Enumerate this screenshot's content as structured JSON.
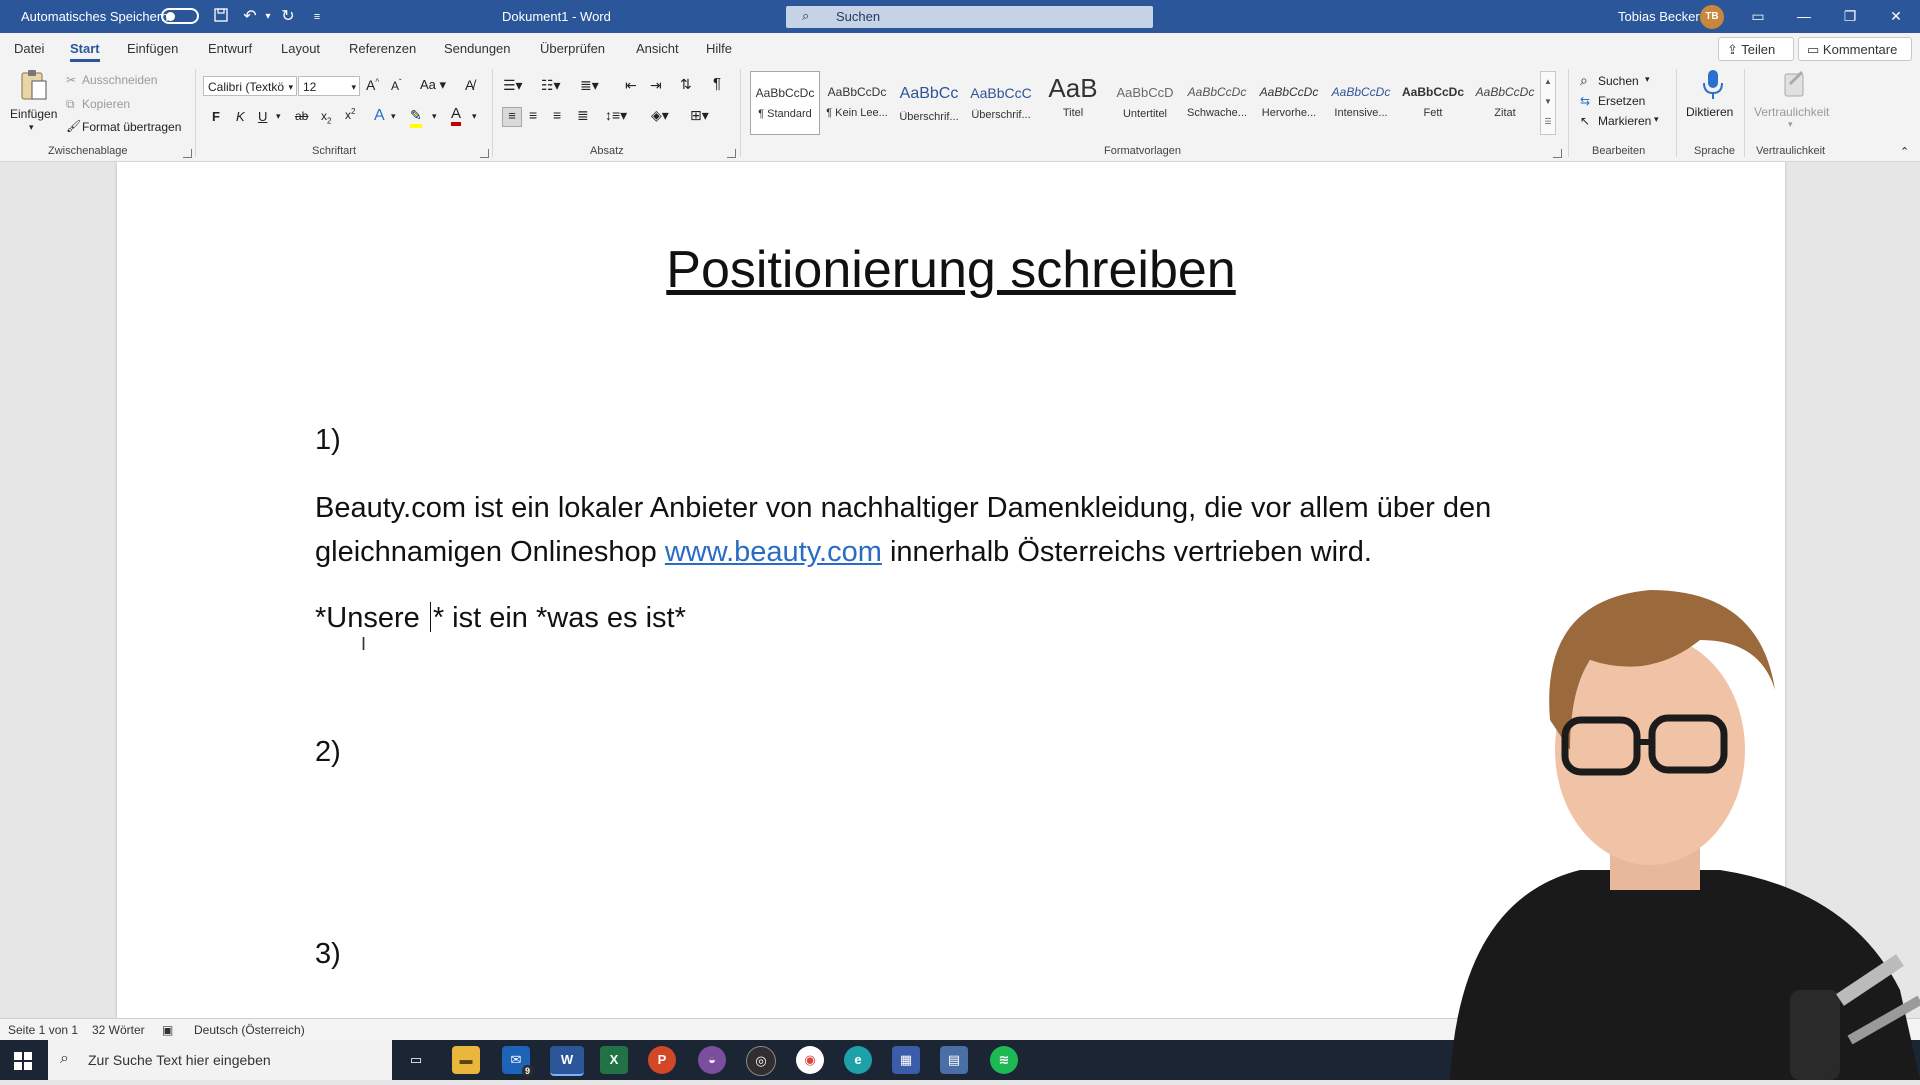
{
  "titlebar": {
    "autosave_label": "Automatisches Speichern",
    "doc_title": "Dokument1 - Word",
    "search_placeholder": "Suchen",
    "user_name": "Tobias Becker",
    "user_initials": "TB",
    "accent": "#2b579a"
  },
  "tabs": [
    "Datei",
    "Start",
    "Einfügen",
    "Entwurf",
    "Layout",
    "Referenzen",
    "Sendungen",
    "Überprüfen",
    "Ansicht",
    "Hilfe"
  ],
  "active_tab": "Start",
  "topbuttons": {
    "share": "Teilen",
    "comments": "Kommentare"
  },
  "ribbon": {
    "clipboard": {
      "paste": "Einfügen",
      "cut": "Ausschneiden",
      "copy": "Kopieren",
      "format_painter": "Format übertragen",
      "label": "Zwischenablage"
    },
    "font": {
      "font_name": "Calibri (Textkö",
      "font_size": "12",
      "bold": "F",
      "italic": "K",
      "underline": "U",
      "label": "Schriftart"
    },
    "paragraph": {
      "label": "Absatz"
    },
    "styles": {
      "items": [
        {
          "preview": "AaBbCcDc",
          "name": "¶ Standard"
        },
        {
          "preview": "AaBbCcDc",
          "name": "¶ Kein Lee..."
        },
        {
          "preview": "AaBbCc",
          "name": "Überschrif..."
        },
        {
          "preview": "AaBbCcC",
          "name": "Überschrif..."
        },
        {
          "preview": "AaB",
          "name": "Titel"
        },
        {
          "preview": "AaBbCcD",
          "name": "Untertitel"
        },
        {
          "preview": "AaBbCcDc",
          "name": "Schwache..."
        },
        {
          "preview": "AaBbCcDc",
          "name": "Hervorhe..."
        },
        {
          "preview": "AaBbCcDc",
          "name": "Intensive..."
        },
        {
          "preview": "AaBbCcDc",
          "name": "Fett"
        },
        {
          "preview": "AaBbCcDc",
          "name": "Zitat"
        }
      ],
      "label": "Formatvorlagen"
    },
    "editing": {
      "find": "Suchen",
      "replace": "Ersetzen",
      "select": "Markieren",
      "label": "Bearbeiten"
    },
    "voice": {
      "dictate": "Diktieren",
      "label": "Sprache"
    },
    "sensitivity": {
      "button": "Vertraulichkeit",
      "label": "Vertraulichkeit"
    }
  },
  "document": {
    "title": "Positionierung schreiben",
    "item1": "1)",
    "para_line1": "Beauty.com ist ein lokaler Anbieter von nachhaltiger Damenkleidung, die vor allem über den",
    "para_line2_pre": "gleichnamigen Onlineshop ",
    "para_link": "www.beauty.com",
    "para_line2_post": " innerhalb Österreichs vertrieben wird.",
    "template_pre": "*Unsere ",
    "template_post": "* ist ein *was es ist*",
    "item2": "2)",
    "item3": "3)"
  },
  "statusbar": {
    "page": "Seite 1 von 1",
    "words": "32 Wörter",
    "language": "Deutsch (Österreich)"
  },
  "taskbar": {
    "search_placeholder": "Zur Suche Text hier eingeben",
    "mail_badge": "9"
  }
}
